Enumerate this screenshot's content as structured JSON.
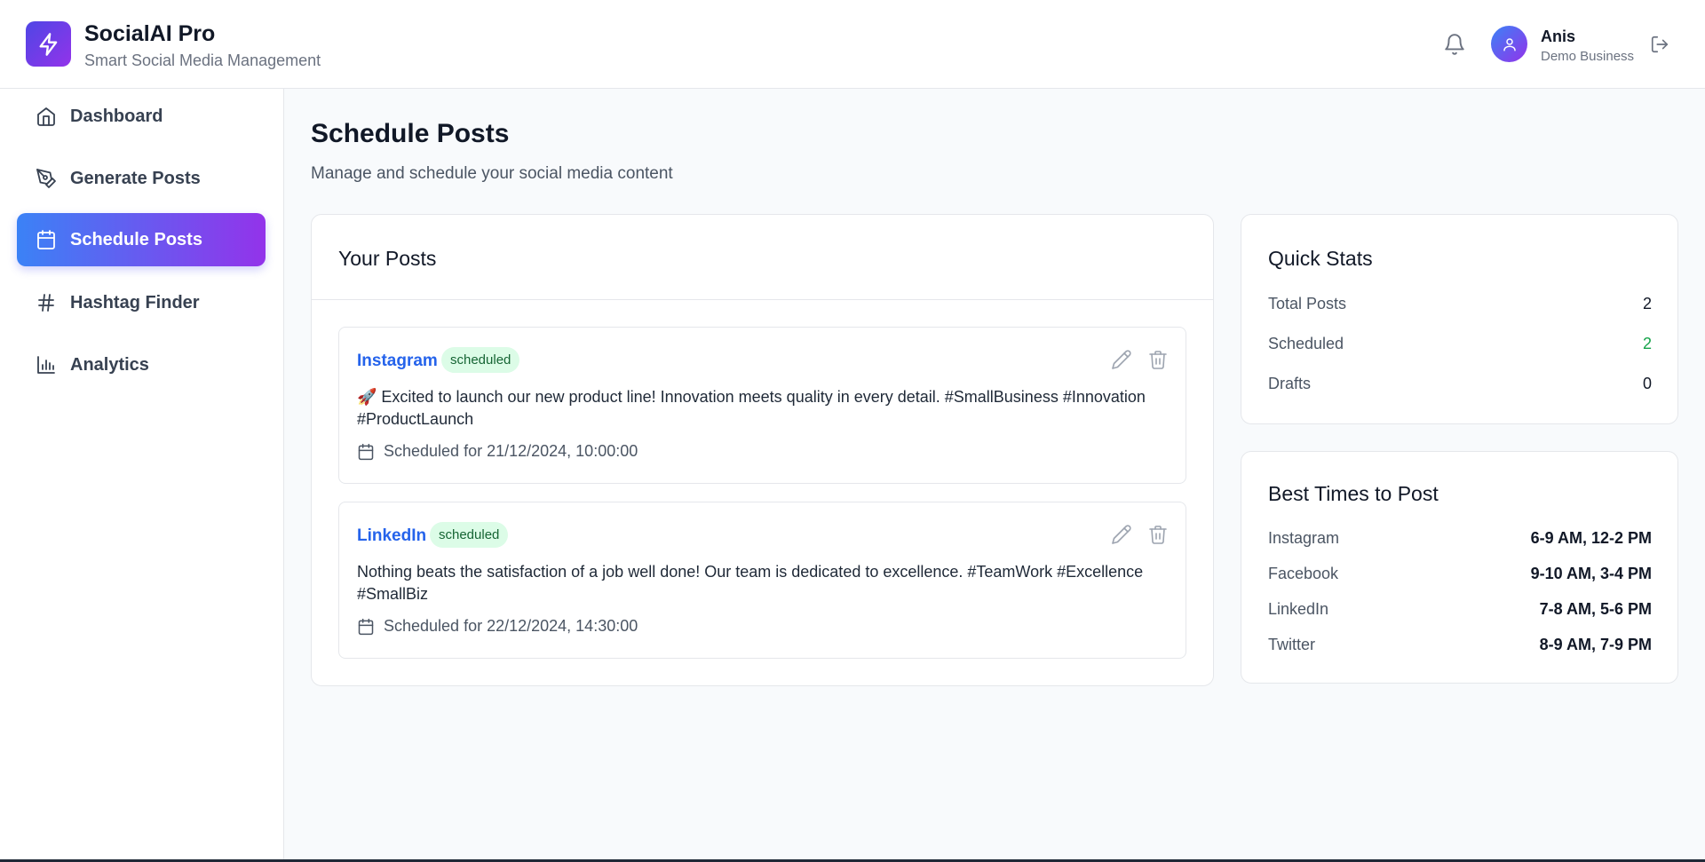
{
  "app": {
    "title": "SocialAI Pro",
    "subtitle": "Smart Social Media Management",
    "icon": "lightning-icon"
  },
  "user": {
    "name": "Anis",
    "business": "Demo Business"
  },
  "sidebar": {
    "items": [
      {
        "label": "Dashboard",
        "icon": "home-icon",
        "active": false
      },
      {
        "label": "Generate Posts",
        "icon": "pen-tool-icon",
        "active": false
      },
      {
        "label": "Schedule Posts",
        "icon": "calendar-icon",
        "active": true
      },
      {
        "label": "Hashtag Finder",
        "icon": "hash-icon",
        "active": false
      },
      {
        "label": "Analytics",
        "icon": "bar-chart-icon",
        "active": false
      }
    ]
  },
  "page": {
    "title": "Schedule Posts",
    "subtitle": "Manage and schedule your social media content"
  },
  "posts": {
    "title": "Your Posts",
    "items": [
      {
        "platform": "Instagram",
        "status": "scheduled",
        "content": "🚀 Excited to launch our new product line! Innovation meets quality in every detail. #SmallBusiness #Innovation #ProductLaunch",
        "schedule": "Scheduled for 21/12/2024, 10:00:00"
      },
      {
        "platform": "LinkedIn",
        "status": "scheduled",
        "content": "Nothing beats the satisfaction of a job well done! Our team is dedicated to excellence. #TeamWork #Excellence #SmallBiz",
        "schedule": "Scheduled for 22/12/2024, 14:30:00"
      }
    ]
  },
  "quick_stats": {
    "title": "Quick Stats",
    "rows": [
      {
        "label": "Total Posts",
        "value": "2"
      },
      {
        "label": "Scheduled",
        "value": "2"
      },
      {
        "label": "Drafts",
        "value": "0"
      }
    ]
  },
  "best_times": {
    "title": "Best Times to Post",
    "rows": [
      {
        "label": "Instagram",
        "value": "6-9 AM, 12-2 PM"
      },
      {
        "label": "Facebook",
        "value": "9-10 AM, 3-4 PM"
      },
      {
        "label": "LinkedIn",
        "value": "7-8 AM, 5-6 PM"
      },
      {
        "label": "Twitter",
        "value": "8-9 AM, 7-9 PM"
      }
    ]
  },
  "colors": {
    "accent_start": "#3b82f6",
    "accent_end": "#9333ea",
    "platform_link": "#2563eb",
    "badge_bg": "#dcfce7",
    "badge_text": "#166534",
    "scheduled_value": "#16a34a"
  }
}
